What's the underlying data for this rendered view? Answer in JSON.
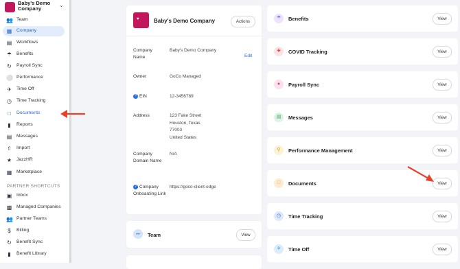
{
  "sidebar": {
    "company_name": "Baby's Demo Company",
    "items": [
      {
        "label": "Team",
        "icon": "users-icon"
      },
      {
        "label": "Company",
        "icon": "building-icon"
      },
      {
        "label": "Workflows",
        "icon": "workflow-icon"
      },
      {
        "label": "Benefits",
        "icon": "umbrella-icon"
      },
      {
        "label": "Payroll Sync",
        "icon": "sync-icon"
      },
      {
        "label": "Performance",
        "icon": "award-icon"
      },
      {
        "label": "Time Off",
        "icon": "plane-icon"
      },
      {
        "label": "Time Tracking",
        "icon": "clock-icon"
      },
      {
        "label": "Documents",
        "icon": "document-icon"
      },
      {
        "label": "Reports",
        "icon": "bar-chart-icon"
      },
      {
        "label": "Messages",
        "icon": "message-icon"
      },
      {
        "label": "Import",
        "icon": "upload-icon"
      },
      {
        "label": "JazzHR",
        "icon": "star-icon"
      },
      {
        "label": "Marketplace",
        "icon": "grid-icon"
      }
    ],
    "partner_label": "PARTNER SHORTCUTS",
    "partner_items": [
      {
        "label": "Inbox",
        "icon": "inbox-icon"
      },
      {
        "label": "Managed Companies",
        "icon": "companies-icon"
      },
      {
        "label": "Partner Teams",
        "icon": "users-icon"
      },
      {
        "label": "Billing",
        "icon": "dollar-icon"
      },
      {
        "label": "Benefit Sync",
        "icon": "sync-icon"
      },
      {
        "label": "Benefit Library",
        "icon": "library-icon"
      }
    ],
    "active_index": 1
  },
  "company_card": {
    "title": "Baby's Demo Company",
    "actions_label": "Actions",
    "edit_label": "Edit",
    "fields": {
      "company_name": {
        "label": "Company Name",
        "value": "Baby's Demo Company"
      },
      "owner": {
        "label": "Owner",
        "value": "GoCo Managed"
      },
      "ein": {
        "label": "EIN",
        "value": "12-3456789"
      },
      "address": {
        "label": "Address",
        "lines": [
          "123 Fake Street",
          "Houston, Texas",
          "77003",
          "United States"
        ]
      },
      "domain": {
        "label": "Company Domain Name",
        "value": "N/A"
      },
      "onboarding": {
        "label": "Company Onboarding Link",
        "value": "https://goco-client-edge"
      }
    }
  },
  "team_card": {
    "title": "Team",
    "button": "View"
  },
  "modules": [
    {
      "title": "Benefits",
      "button": "View",
      "icon": "umbrella-icon",
      "color": "#8a5cf5"
    },
    {
      "title": "COVID Tracking",
      "button": "View",
      "icon": "syringe-icon",
      "color": "#e05252"
    },
    {
      "title": "Payroll Sync",
      "button": "View",
      "icon": "payroll-icon",
      "color": "#d63d84"
    },
    {
      "title": "Messages",
      "button": "View",
      "icon": "message-icon",
      "color": "#3aa55a"
    },
    {
      "title": "Performance Management",
      "button": "View",
      "icon": "award-icon",
      "color": "#d4a017"
    },
    {
      "title": "Documents",
      "button": "View",
      "icon": "document-icon",
      "color": "#e59a2f"
    },
    {
      "title": "Time Tracking",
      "button": "View",
      "icon": "clock-icon",
      "color": "#2a6fdb"
    },
    {
      "title": "Time Off",
      "button": "View",
      "icon": "plane-icon",
      "color": "#2a8fdb"
    }
  ],
  "colors": {
    "accent": "#2563c9",
    "arrow": "#e8412c",
    "logo": "#c2185b"
  }
}
